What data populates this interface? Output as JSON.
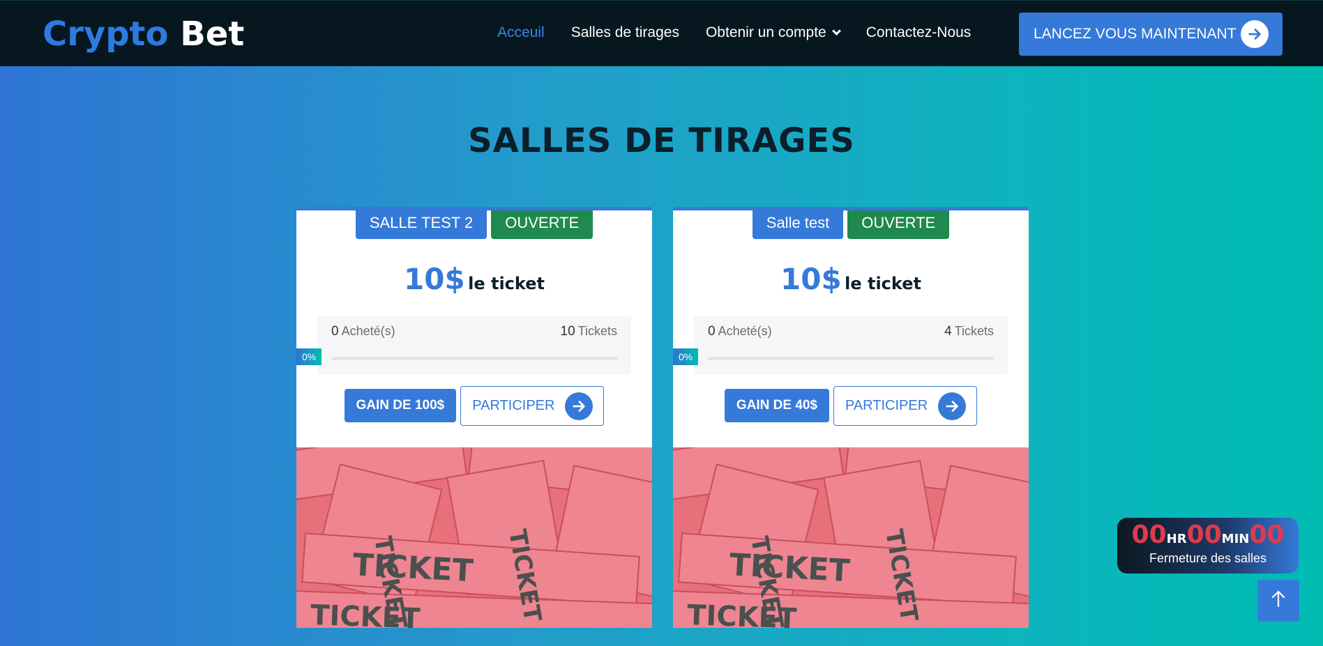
{
  "brand": {
    "part1": "Crypto",
    "part2": "Bet"
  },
  "nav": {
    "items": [
      {
        "label": "Acceuil",
        "active": true
      },
      {
        "label": "Salles de tirages"
      },
      {
        "label": "Obtenir un compte"
      },
      {
        "label": "Contactez-Nous"
      }
    ],
    "cta_label": "LANCEZ VOUS MAINTENANT"
  },
  "section": {
    "title": "SALLES DE TIRAGES"
  },
  "rooms": [
    {
      "name": "SALLE TEST 2",
      "status": "OUVERTE",
      "price": "10$",
      "price_unit": "le ticket",
      "bought_count": "0",
      "bought_label": "Acheté(s)",
      "tickets_count": "10",
      "tickets_label": "Tickets",
      "progress_label": "0%",
      "gain_label": "GAIN DE 100$",
      "participer_label": "PARTICIPER",
      "image_text": "TICKET"
    },
    {
      "name": "Salle test",
      "status": "OUVERTE",
      "price": "10$",
      "price_unit": "le ticket",
      "bought_count": "0",
      "bought_label": "Acheté(s)",
      "tickets_count": "4",
      "tickets_label": "Tickets",
      "progress_label": "0%",
      "gain_label": "GAIN DE 40$",
      "participer_label": "PARTICIPER",
      "image_text": "TICKET"
    }
  ],
  "timer": {
    "hours": "00",
    "hours_unit": "HR",
    "minutes": "00",
    "minutes_unit": "MIN",
    "seconds": "00",
    "caption": "Fermeture des salles"
  },
  "icons": {
    "cta": "arrow-right-icon",
    "participer": "arrow-right-icon",
    "dropdown": "chevron-down-icon",
    "scroll_top": "arrow-up-icon"
  },
  "colors": {
    "primary": "#3579d9",
    "status_open": "#1e8a4e",
    "nav_bg": "#06171f",
    "timer_digits": "#e23a4a"
  }
}
